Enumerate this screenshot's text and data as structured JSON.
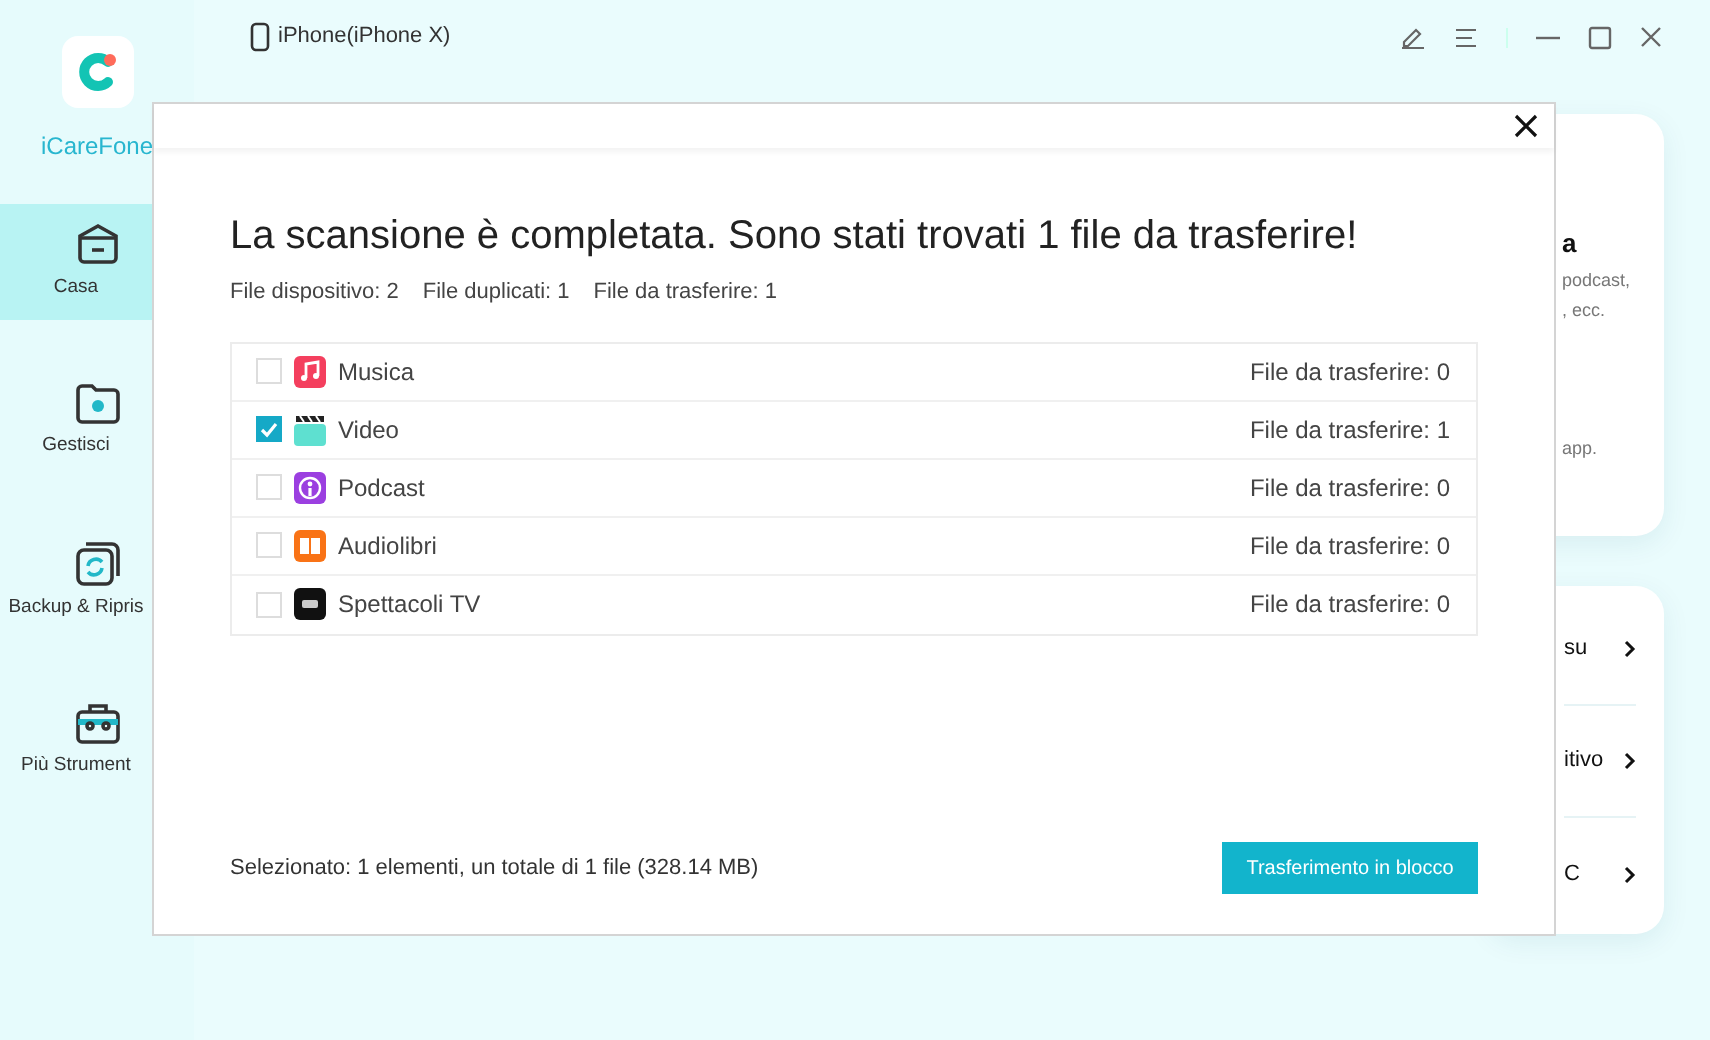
{
  "app": {
    "name": "iCareFone",
    "device": "iPhone(iPhone X)"
  },
  "sidebar": {
    "items": [
      {
        "label": "Casa",
        "kind": "home",
        "selected": true
      },
      {
        "label": "Gestisci",
        "kind": "manage",
        "selected": false
      },
      {
        "label": "Backup & Ripris",
        "kind": "backup",
        "selected": false
      },
      {
        "label": "Più Strument",
        "kind": "tools",
        "selected": false
      }
    ]
  },
  "background_cards": {
    "card_1": {
      "title": "a",
      "lines": [
        "podcast,",
        ", ecc.",
        "app."
      ]
    },
    "card_2": {
      "items": [
        "su",
        "itivo",
        "C"
      ]
    }
  },
  "dialog": {
    "title": "La scansione è completata. Sono stati trovati 1 file da trasferire!",
    "stats": [
      "File dispositivo: 2",
      "File duplicati: 1",
      "File da trasferire: 1"
    ],
    "rows": [
      {
        "name": "Musica",
        "kind": "music",
        "checked": false,
        "count": "File da trasferire: 0"
      },
      {
        "name": "Video",
        "kind": "video",
        "checked": true,
        "count": "File da trasferire: 1"
      },
      {
        "name": "Podcast",
        "kind": "podcast",
        "checked": false,
        "count": "File da trasferire: 0"
      },
      {
        "name": "Audiolibri",
        "kind": "audiobook",
        "checked": false,
        "count": "File da trasferire: 0"
      },
      {
        "name": "Spettacoli TV",
        "kind": "tv",
        "checked": false,
        "count": "File da trasferire: 0"
      }
    ],
    "summary": "Selezionato: 1 elementi, un totale di 1 file (328.14 MB)",
    "button": "Trasferimento in blocco"
  }
}
